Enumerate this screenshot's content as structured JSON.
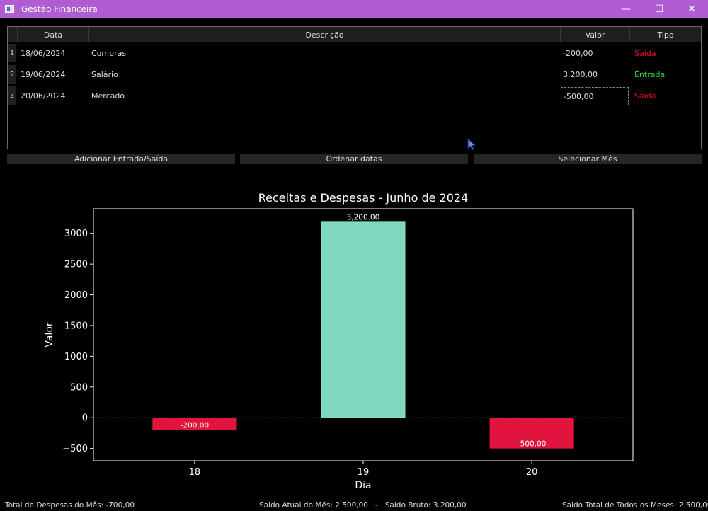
{
  "window": {
    "title": "Gestão Financeira",
    "minimize_glyph": "—",
    "maximize_glyph": "☐",
    "close_glyph": "✕",
    "icon": "app-window-icon",
    "titlebar_color": "#b05cd2"
  },
  "table": {
    "headers": [
      "Data",
      "Descrição",
      "Valor",
      "Tipo"
    ],
    "rows": [
      {
        "num": "1",
        "date": "18/06/2024",
        "desc": "Compras",
        "value": "-200,00",
        "type": "Saída"
      },
      {
        "num": "2",
        "date": "19/06/2024",
        "desc": "Salário",
        "value": "3.200,00",
        "type": "Entrada"
      },
      {
        "num": "3",
        "date": "20/06/2024",
        "desc": "Mercado",
        "value": "-500,00",
        "type": "Saída"
      }
    ],
    "colors": {
      "entrada": "#2ecc40",
      "saida": "#e0102e"
    }
  },
  "buttons": {
    "add": "Adicionar Entrada/Saída",
    "sort": "Ordenar datas",
    "month": "Selecionar Mês"
  },
  "chart_data": {
    "type": "bar",
    "title": "Receitas e Despesas - Junho de 2024",
    "xlabel": "Dia",
    "ylabel": "Valor",
    "categories": [
      "18",
      "19",
      "20"
    ],
    "values": [
      -200,
      3200,
      -500
    ],
    "data_labels": [
      "-200.00",
      "3,200.00",
      "-500.00"
    ],
    "ylim": [
      -700,
      3400
    ],
    "yticks": [
      -500,
      0,
      500,
      1000,
      1500,
      2000,
      2500,
      3000
    ],
    "ytick_labels": [
      "−500",
      "0",
      "500",
      "1000",
      "1500",
      "2000",
      "2500",
      "3000"
    ],
    "colors": {
      "positive": "#7fd8c0",
      "negative": "#e0143c"
    },
    "zero_line": "dashed"
  },
  "status": {
    "despesas": "Total de Despesas do Mês: -700,00",
    "saldo": "Saldo Atual do Mês: 2.500,00   -   Saldo Bruto: 3.200,00",
    "total": "Saldo Total de Todos os Meses: 2.500,00"
  }
}
